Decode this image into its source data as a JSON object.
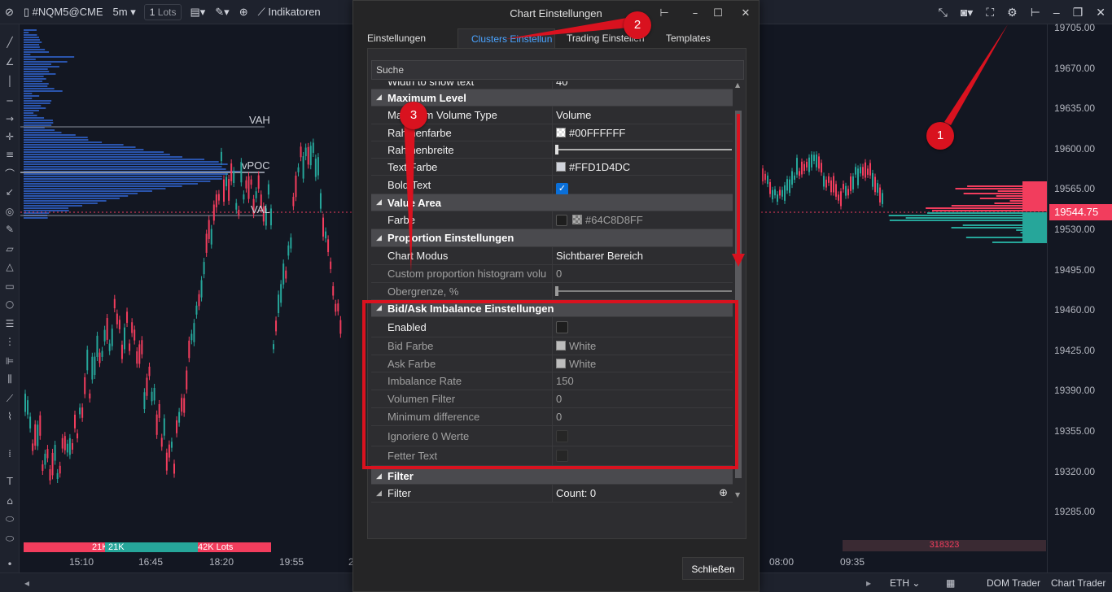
{
  "toolbar": {
    "symbol": "#NQM5@CME",
    "timeframe": "5m",
    "lots_qty": "1",
    "lots_label": "Lots",
    "indicators_label": "Indikatoren"
  },
  "chart": {
    "levels": {
      "vah": "VAH",
      "vpoc": "vPOC",
      "val": "VAL"
    },
    "price_ticks": [
      "19705.00",
      "19670.00",
      "19635.00",
      "19600.00",
      "19565.00",
      "19530.00",
      "19495.00",
      "19460.00",
      "19425.00",
      "19390.00",
      "19355.00",
      "19320.00",
      "19285.00"
    ],
    "current_price": "19544.75",
    "time_ticks": [
      "15:10",
      "16:45",
      "18:20",
      "19:55",
      "2",
      "08:00",
      "09:35"
    ],
    "volume_left_a": "21K",
    "volume_left_b": "21K",
    "volume_left_c": "42K Lots",
    "volume_right": "318323",
    "colors": {
      "up": "#26a69a",
      "down": "#f23d5d",
      "profile": "#2f5fc4"
    }
  },
  "bottombar": {
    "session": "ETH",
    "dom_trader": "DOM Trader",
    "chart_trader": "Chart Trader"
  },
  "dialog": {
    "title": "Chart Einstellungen",
    "tabs": [
      "Einstellungen",
      "Clusters Einstellun",
      "Trading Einstellen",
      "Templates"
    ],
    "search_placeholder": "Suche",
    "rows": {
      "width_show_text": {
        "name": "Width to show text",
        "value": "40"
      },
      "max_level": "Maximum Level",
      "max_vol_type": {
        "name": "Maximum Volume Type",
        "value": "Volume"
      },
      "rahmenfarbe": {
        "name": "Rahmenfarbe",
        "value": "#00FFFFFF"
      },
      "rahmenbreite": {
        "name": "Rahmenbreite"
      },
      "text_farbe": {
        "name": "Text Farbe",
        "value": "#FFD1D4DC"
      },
      "bold_text": {
        "name": "Bold Text"
      },
      "value_area": "Value Area",
      "farbe": {
        "name": "Farbe",
        "value": "#64C8D8FF"
      },
      "proportion": "Proportion Einstellungen",
      "chart_modus": {
        "name": "Chart Modus",
        "value": "Sichtbarer Bereich"
      },
      "custom_prop": {
        "name": "Custom proportion histogram volu",
        "value": "0"
      },
      "obergrenze": {
        "name": "Obergrenze, %"
      },
      "bid_ask": "Bid/Ask Imbalance Einstellungen",
      "enabled": {
        "name": "Enabled"
      },
      "bid_farbe": {
        "name": "Bid Farbe",
        "value": "White"
      },
      "ask_farbe": {
        "name": "Ask Farbe",
        "value": "White"
      },
      "imbalance_rate": {
        "name": "Imbalance Rate",
        "value": "150"
      },
      "volumen_filter": {
        "name": "Volumen Filter",
        "value": "0"
      },
      "min_diff": {
        "name": "Minimum difference",
        "value": "0"
      },
      "ignoriere": {
        "name": "Ignoriere 0 Werte"
      },
      "fetter_text": {
        "name": "Fetter Text"
      },
      "filter_cat": "Filter",
      "filter": {
        "name": "Filter",
        "value": "Count: 0"
      }
    },
    "close_label": "Schließen"
  },
  "annotations": {
    "one": "1",
    "two": "2",
    "three": "3"
  }
}
